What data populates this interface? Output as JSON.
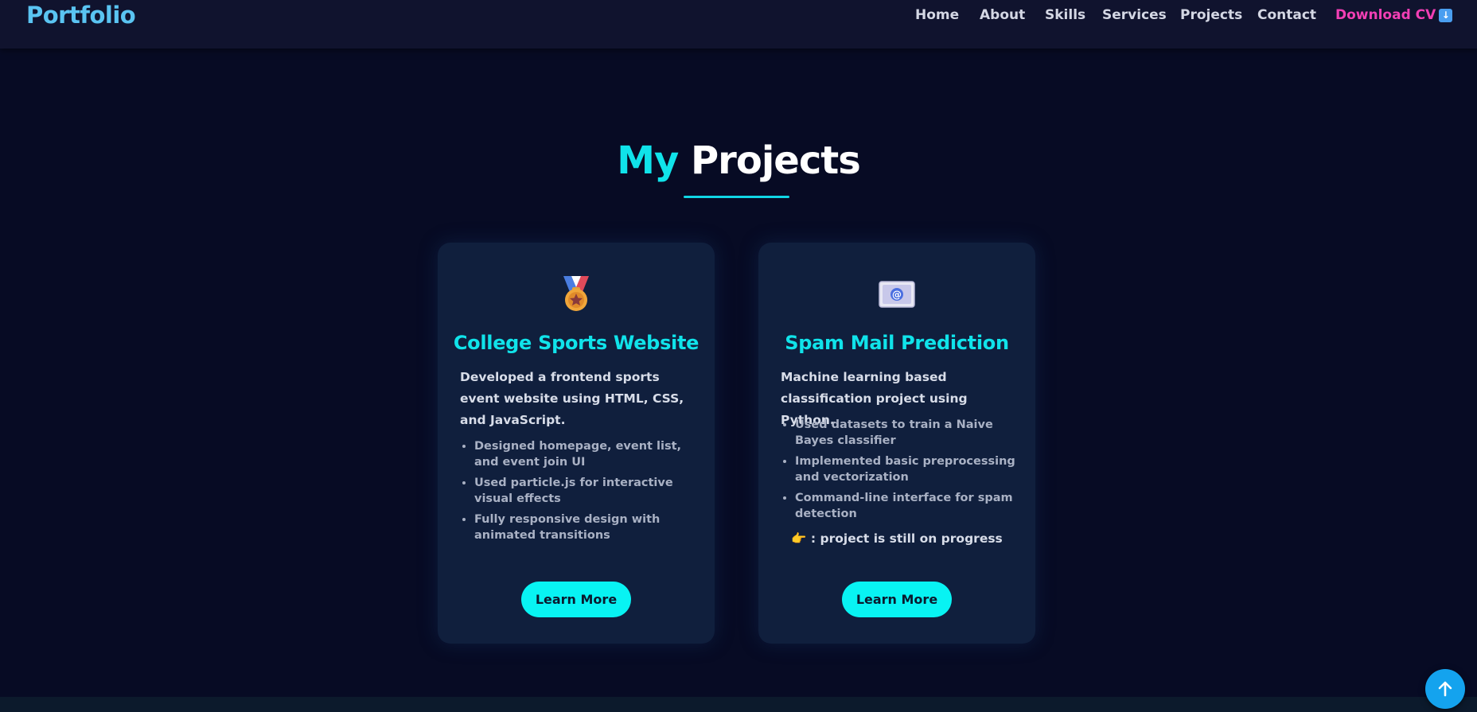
{
  "navbar": {
    "logo": "Portfolio",
    "links": [
      "Home",
      "About",
      "Skills",
      "Services",
      "Projects",
      "Contact"
    ],
    "download_cv": "Download CV",
    "download_cv_icon": "down-arrow-icon"
  },
  "section": {
    "title_highlight": "My",
    "title_rest": "Projects"
  },
  "projects": [
    {
      "icon": "medal-icon",
      "title": "College Sports Website",
      "description": "Developed a frontend sports event website using HTML, CSS, and JavaScript.",
      "bullets": [
        "Designed homepage, event list, and event join UI",
        "Used particle.js for interactive visual effects",
        "Fully responsive design with animated transitions"
      ],
      "note": "",
      "button": "Learn More"
    },
    {
      "icon": "email-icon",
      "title": "Spam Mail Prediction",
      "description": "Machine learning based classification project using Python.",
      "bullets": [
        "Used datasets to train a Naive Bayes classifier",
        "Implemented basic preprocessing and vectorization",
        "Command-line interface for spam detection"
      ],
      "note": "👉 : project is still on progress",
      "button": "Learn More"
    }
  ],
  "scroll_top_icon": "arrow-up-icon",
  "colors": {
    "background": "#070b24",
    "navbar": "#10132e",
    "accent_cyan": "#10e3ea",
    "logo_blue": "#5ac4f2",
    "cv_pink": "#f23fb4",
    "card_bg": "#101f3d",
    "button_bg": "#08f3f3",
    "scroll_button": "#14a3ee"
  }
}
